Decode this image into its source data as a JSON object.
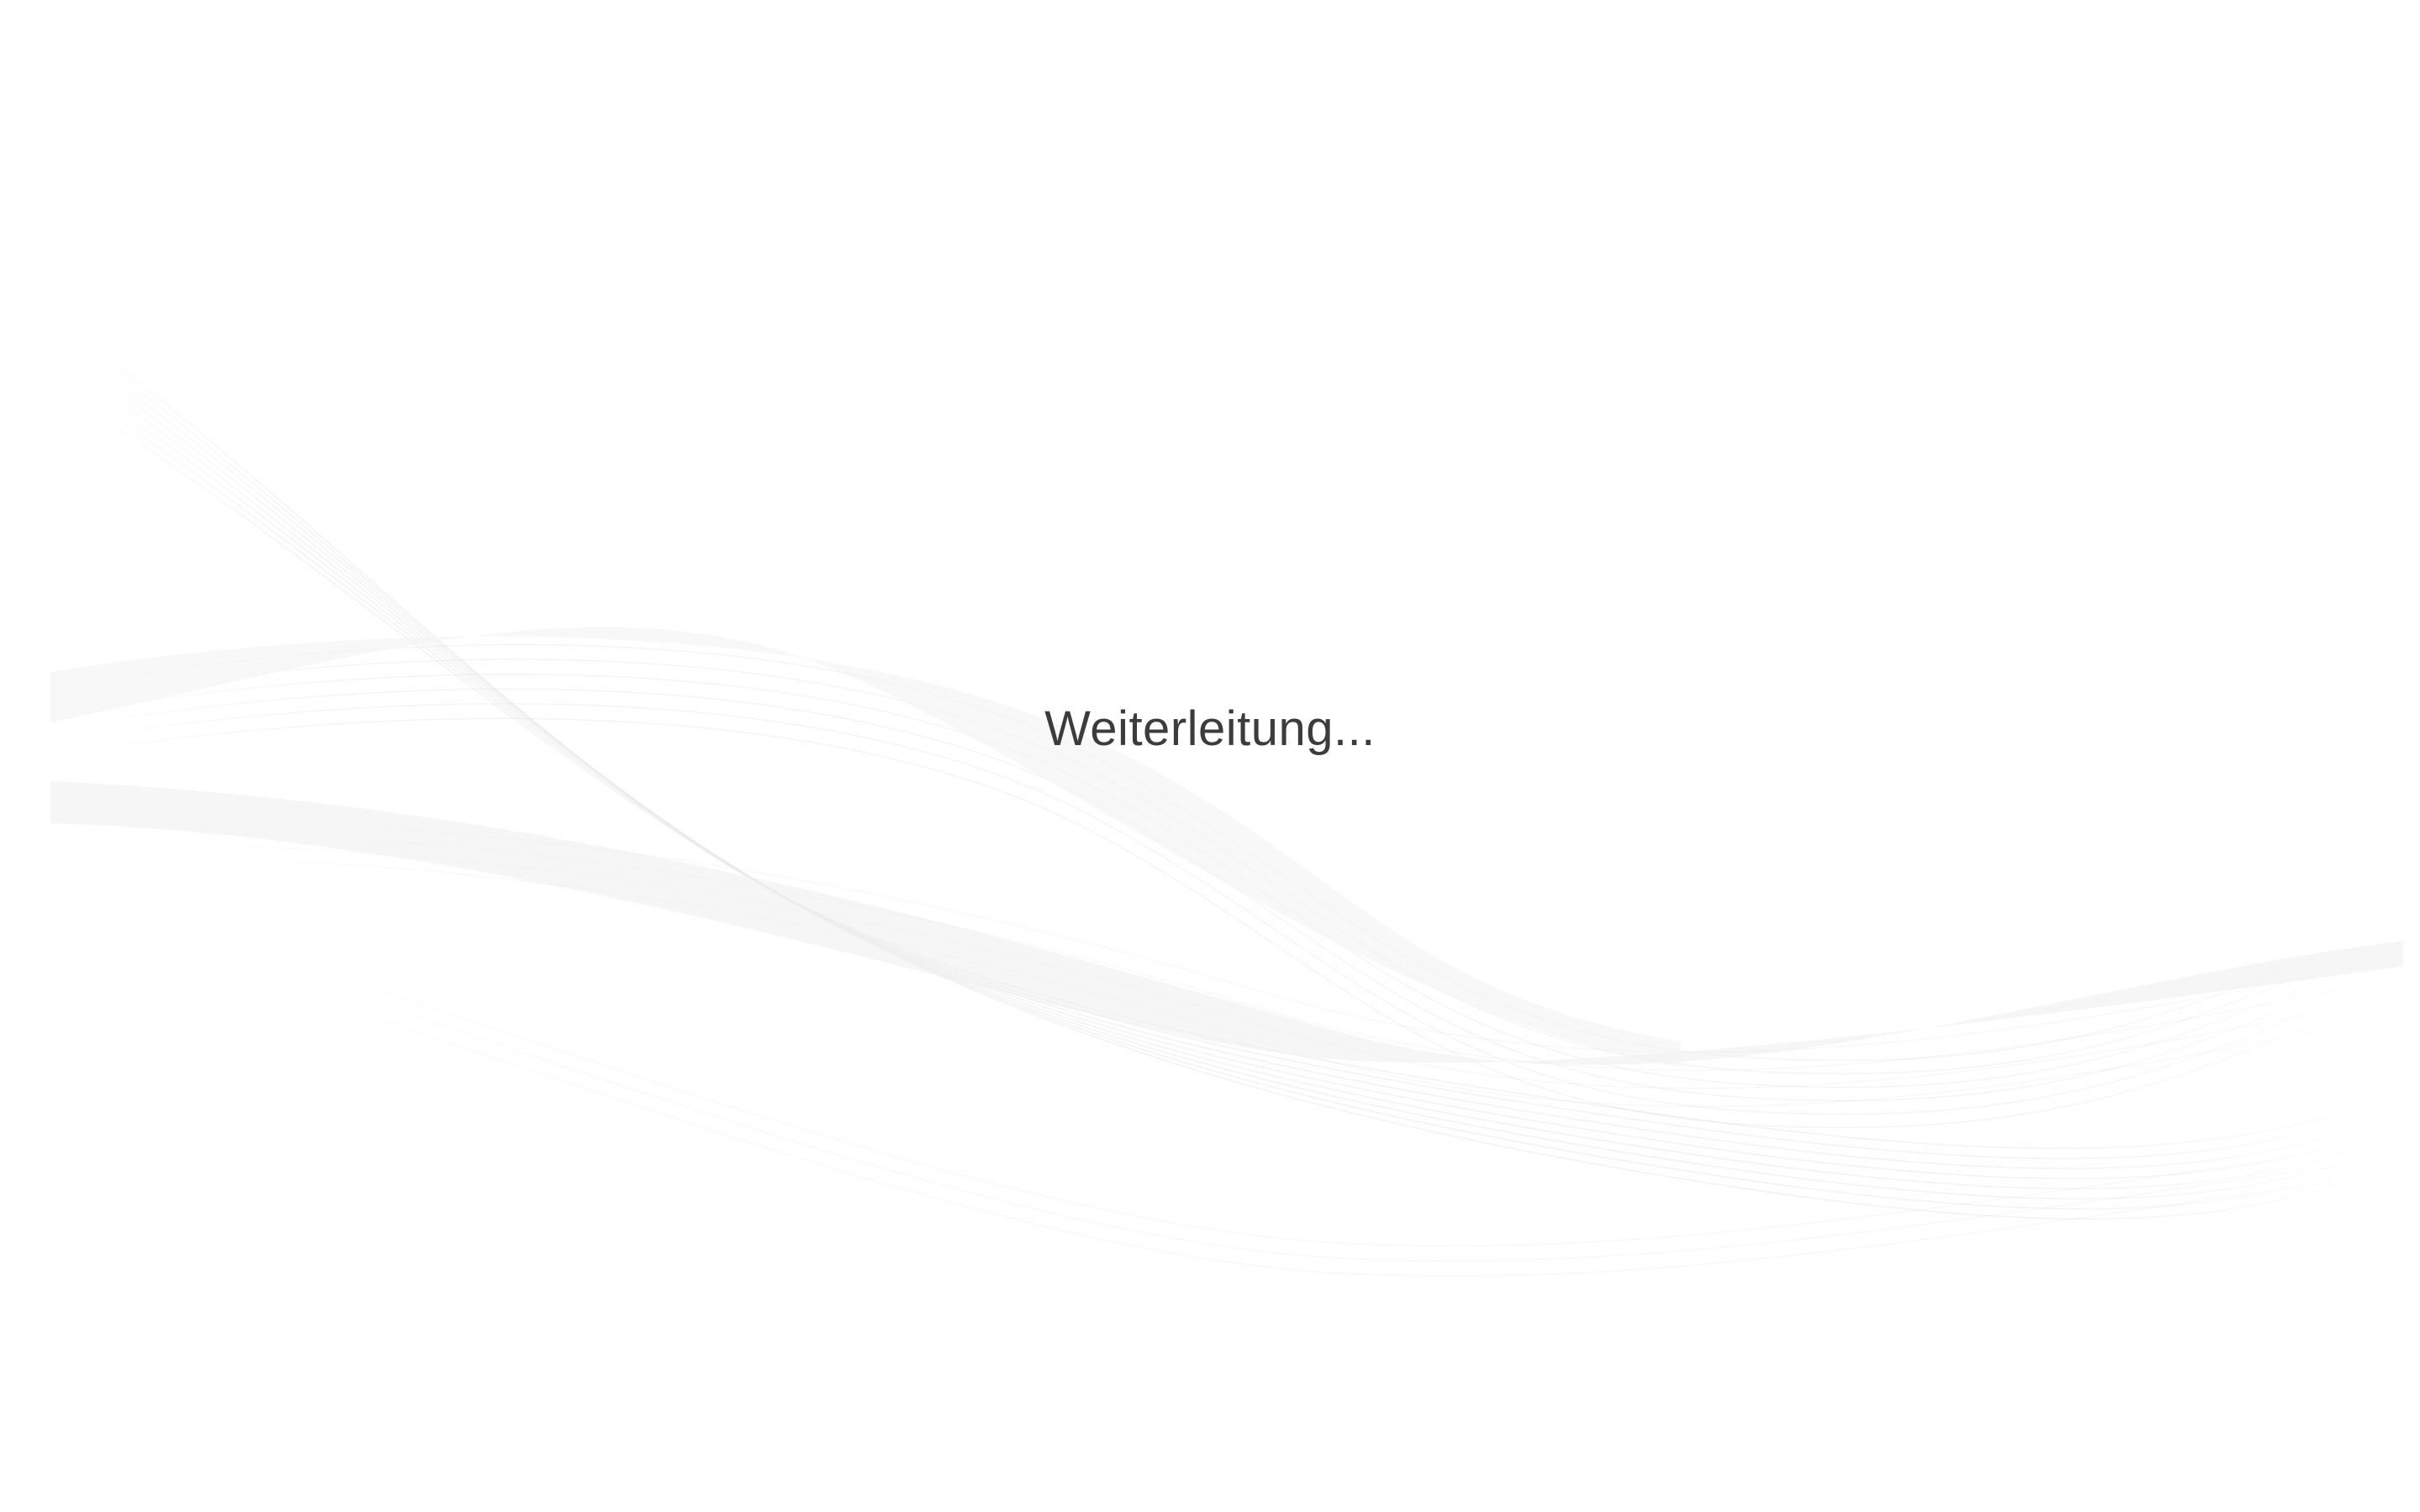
{
  "status": {
    "message": "Weiterleitung..."
  },
  "colors": {
    "background": "#ffffff",
    "text": "#3c3c3c",
    "wave": "#e6e6e6"
  }
}
